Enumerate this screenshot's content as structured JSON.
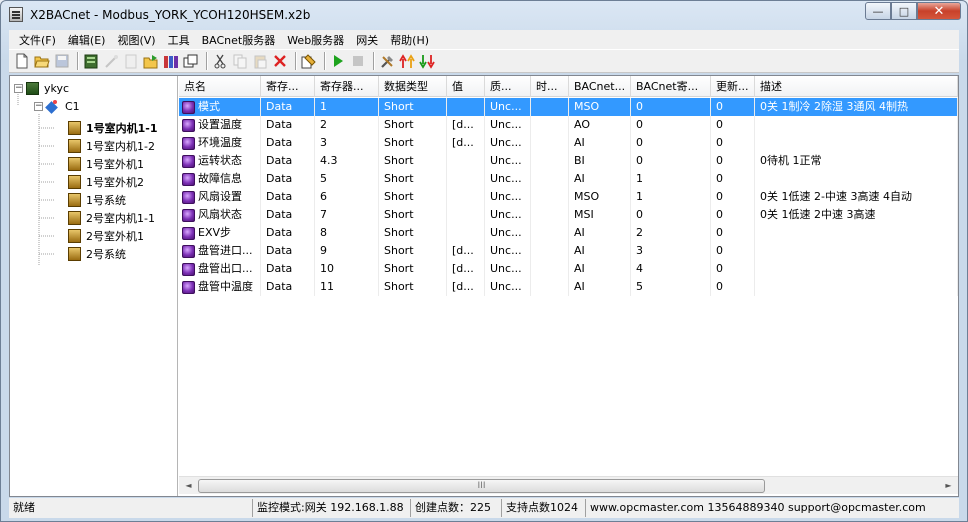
{
  "window": {
    "title": "X2BACnet - Modbus_YORK_YCOH120HSEM.x2b",
    "minimize_label": "—",
    "maximize_label": "□",
    "close_label": "✕"
  },
  "menu": [
    "文件(F)",
    "编辑(E)",
    "视图(V)",
    "工具",
    "BACnet服务器",
    "Web服务器",
    "网关",
    "帮助(H)"
  ],
  "toolbar_icons": [
    "new-file-icon",
    "open-folder-icon",
    "save-icon",
    "database-icon",
    "wand-icon",
    "page-icon",
    "export-icon",
    "books-icon",
    "multi-window-icon",
    "cut-icon",
    "copy-icon",
    "paste-icon",
    "delete-icon",
    "tag-properties-icon",
    "play-icon",
    "stop-icon",
    "tools-icon",
    "upload-icon",
    "download-icon"
  ],
  "tree": {
    "root": "ykyc",
    "channel": "C1",
    "devices": [
      "1号室内机1-1",
      "1号室内机1-2",
      "1号室外机1",
      "1号室外机2",
      "1号系统",
      "2号室内机1-1",
      "2号室外机1",
      "2号系统"
    ],
    "selected_device": "1号室内机1-1"
  },
  "columns": [
    "点名",
    "寄存...",
    "寄存器...",
    "数据类型",
    "值",
    "质...",
    "时...",
    "BACnet...",
    "BACnet寄...",
    "更新...",
    "描述"
  ],
  "rows": [
    [
      "模式",
      "Data",
      "1",
      "Short",
      "",
      "Unc...",
      "",
      "MSO",
      "0",
      "0",
      "0关 1制冷 2除湿 3通风 4制热"
    ],
    [
      "设置温度",
      "Data",
      "2",
      "Short",
      "[d...",
      "Unc...",
      "",
      "AO",
      "0",
      "0",
      ""
    ],
    [
      "环境温度",
      "Data",
      "3",
      "Short",
      "[d...",
      "Unc...",
      "",
      "AI",
      "0",
      "0",
      ""
    ],
    [
      "运转状态",
      "Data",
      "4.3",
      "Short",
      "",
      "Unc...",
      "",
      "BI",
      "0",
      "0",
      "0待机  1正常"
    ],
    [
      "故障信息",
      "Data",
      "5",
      "Short",
      "",
      "Unc...",
      "",
      "AI",
      "1",
      "0",
      ""
    ],
    [
      "风扇设置",
      "Data",
      "6",
      "Short",
      "",
      "Unc...",
      "",
      "MSO",
      "1",
      "0",
      "0关 1低速 2-中速 3高速 4自动"
    ],
    [
      "风扇状态",
      "Data",
      "7",
      "Short",
      "",
      "Unc...",
      "",
      "MSI",
      "0",
      "0",
      "0关 1低速 2中速 3高速"
    ],
    [
      "EXV步",
      "Data",
      "8",
      "Short",
      "",
      "Unc...",
      "",
      "AI",
      "2",
      "0",
      ""
    ],
    [
      "盘管进口...",
      "Data",
      "9",
      "Short",
      "[d...",
      "Unc...",
      "",
      "AI",
      "3",
      "0",
      ""
    ],
    [
      "盘管出口...",
      "Data",
      "10",
      "Short",
      "[d...",
      "Unc...",
      "",
      "AI",
      "4",
      "0",
      ""
    ],
    [
      "盘管中温度",
      "Data",
      "11",
      "Short",
      "[d...",
      "Unc...",
      "",
      "AI",
      "5",
      "0",
      ""
    ]
  ],
  "selected_row": 0,
  "scrollbar": {
    "thumb_label": "III"
  },
  "status": {
    "ready": "就绪",
    "mode": "监控模式:网关 192.168.1.88",
    "created": "创建点数：225",
    "supported": "支持点数1024",
    "contact": "www.opcmaster.com 13564889340 support@opcmaster.com"
  }
}
